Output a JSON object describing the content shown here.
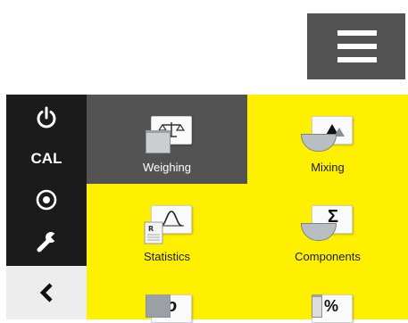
{
  "header": {
    "menu_icon": "hamburger-menu-icon"
  },
  "sidebar": {
    "items": [
      {
        "name": "power",
        "icon": "power-icon"
      },
      {
        "name": "cal",
        "label": "CAL"
      },
      {
        "name": "target",
        "icon": "target-icon"
      },
      {
        "name": "settings",
        "icon": "wrench-icon"
      },
      {
        "name": "back",
        "icon": "chevron-left-icon"
      }
    ]
  },
  "apps": {
    "tiles": [
      {
        "label": "Weighing",
        "icon": "balance-icon",
        "active": true
      },
      {
        "label": "Mixing",
        "icon": "mixing-icon",
        "active": false
      },
      {
        "label": "Statistics",
        "icon": "statistics-icon",
        "active": false
      },
      {
        "label": "Components",
        "icon": "components-sigma-icon",
        "active": false
      },
      {
        "label": "",
        "icon": "density-icon",
        "symbol": "ρ"
      },
      {
        "label": "",
        "icon": "percent-icon",
        "symbol": "%"
      }
    ]
  },
  "colors": {
    "accent": "#fff000",
    "active_tile": "#535353",
    "sidebar": "#1b1b1b",
    "back_button": "#ededed"
  }
}
